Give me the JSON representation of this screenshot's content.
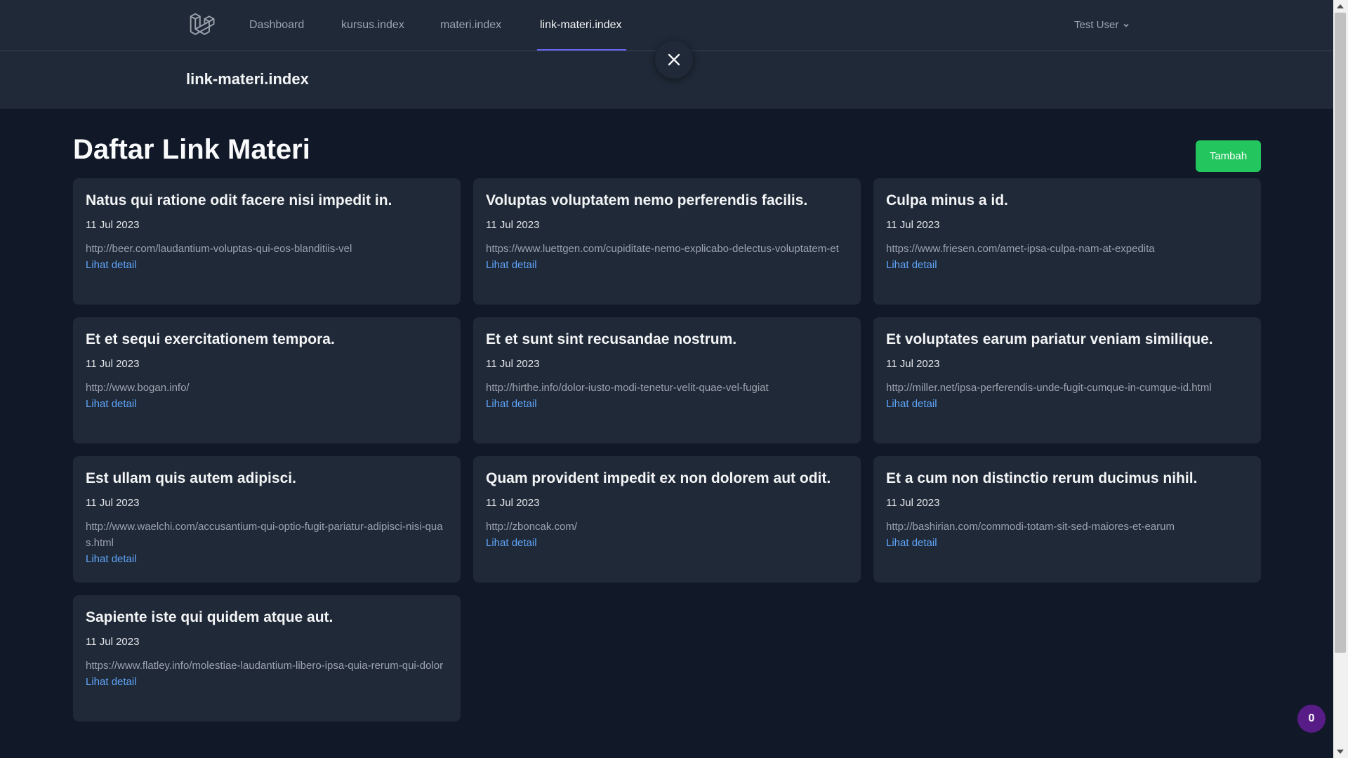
{
  "nav": {
    "links": [
      {
        "label": "Dashboard",
        "active": false
      },
      {
        "label": "kursus.index",
        "active": false
      },
      {
        "label": "materi.index",
        "active": false
      },
      {
        "label": "link-materi.index",
        "active": true
      }
    ],
    "user_name": "Test User"
  },
  "header": {
    "title": "link-materi.index"
  },
  "main": {
    "heading": "Daftar Link Materi",
    "add_button": "Tambah",
    "cards": [
      {
        "title": "Natus qui ratione odit facere nisi impedit in.",
        "date": "11 Jul 2023",
        "url": "http://beer.com/laudantium-voluptas-qui-eos-blanditiis-vel",
        "link": "Lihat detail"
      },
      {
        "title": "Voluptas voluptatem nemo perferendis facilis.",
        "date": "11 Jul 2023",
        "url": "https://www.luettgen.com/cupiditate-nemo-explicabo-delectus-voluptatem-et",
        "link": "Lihat detail"
      },
      {
        "title": "Culpa minus a id.",
        "date": "11 Jul 2023",
        "url": "https://www.friesen.com/amet-ipsa-culpa-nam-at-expedita",
        "link": "Lihat detail"
      },
      {
        "title": "Et et sequi exercitationem tempora.",
        "date": "11 Jul 2023",
        "url": "http://www.bogan.info/",
        "link": "Lihat detail"
      },
      {
        "title": "Et et sunt sint recusandae nostrum.",
        "date": "11 Jul 2023",
        "url": "http://hirthe.info/dolor-iusto-modi-tenetur-velit-quae-vel-fugiat",
        "link": "Lihat detail"
      },
      {
        "title": "Et voluptates earum pariatur veniam similique.",
        "date": "11 Jul 2023",
        "url": "http://miller.net/ipsa-perferendis-unde-fugit-cumque-in-cumque-id.html",
        "link": "Lihat detail"
      },
      {
        "title": "Est ullam quis autem adipisci.",
        "date": "11 Jul 2023",
        "url": "http://www.waelchi.com/accusantium-qui-optio-fugit-pariatur-adipisci-nisi-quas.html",
        "link": "Lihat detail"
      },
      {
        "title": "Quam provident impedit ex non dolorem aut odit.",
        "date": "11 Jul 2023",
        "url": "http://zboncak.com/",
        "link": "Lihat detail"
      },
      {
        "title": "Et a cum non distinctio rerum ducimus nihil.",
        "date": "11 Jul 2023",
        "url": "http://bashirian.com/commodi-totam-sit-sed-maiores-et-earum",
        "link": "Lihat detail"
      },
      {
        "title": "Sapiente iste qui quidem atque aut.",
        "date": "11 Jul 2023",
        "url": "https://www.flatley.info/molestiae-laudantium-libero-ipsa-quia-rerum-qui-dolor",
        "link": "Lihat detail"
      }
    ]
  },
  "badge": {
    "count": "0"
  },
  "icons": {
    "logo": "laravel-logo-icon",
    "user_menu": "chevron-down-icon",
    "close": "close-icon"
  },
  "colors": {
    "background": "#111827",
    "surface": "#1f2937",
    "accent": "#6366f1",
    "add_button": "#22c55e",
    "link": "#60a5fa",
    "badge": "#581c87"
  }
}
